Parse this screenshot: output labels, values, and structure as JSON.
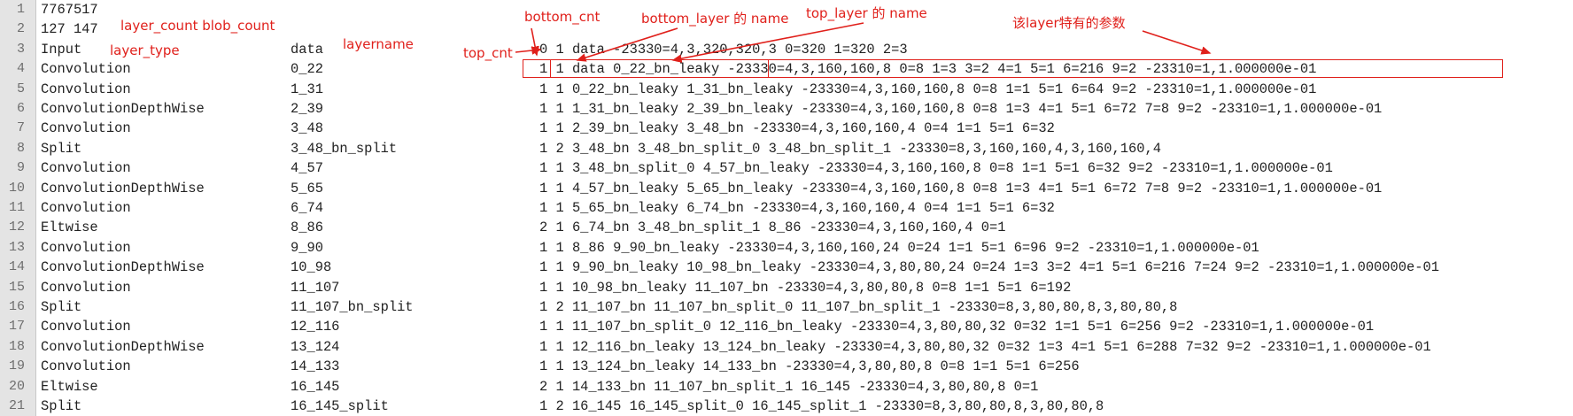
{
  "editor": {
    "lines": [
      {
        "num": "1",
        "type": "7767517",
        "name": "",
        "rest": ""
      },
      {
        "num": "2",
        "type": "127 147",
        "name": "",
        "rest": ""
      },
      {
        "num": "3",
        "type": "Input",
        "name": "data",
        "rest": "0 1 data -23330=4,3,320,320,3 0=320 1=320 2=3"
      },
      {
        "num": "4",
        "type": "Convolution",
        "name": "0_22",
        "rest": "1 1 data 0_22_bn_leaky -23330=4,3,160,160,8 0=8 1=3 3=2 4=1 5=1 6=216 9=2 -23310=1,1.000000e-01"
      },
      {
        "num": "5",
        "type": "Convolution",
        "name": "1_31",
        "rest": "1 1 0_22_bn_leaky 1_31_bn_leaky -23330=4,3,160,160,8 0=8 1=1 5=1 6=64 9=2 -23310=1,1.000000e-01"
      },
      {
        "num": "6",
        "type": "ConvolutionDepthWise",
        "name": "2_39",
        "rest": "1 1 1_31_bn_leaky 2_39_bn_leaky -23330=4,3,160,160,8 0=8 1=3 4=1 5=1 6=72 7=8 9=2 -23310=1,1.000000e-01"
      },
      {
        "num": "7",
        "type": "Convolution",
        "name": "3_48",
        "rest": "1 1 2_39_bn_leaky 3_48_bn -23330=4,3,160,160,4 0=4 1=1 5=1 6=32"
      },
      {
        "num": "8",
        "type": "Split",
        "name": "3_48_bn_split",
        "rest": "1 2 3_48_bn 3_48_bn_split_0 3_48_bn_split_1 -23330=8,3,160,160,4,3,160,160,4"
      },
      {
        "num": "9",
        "type": "Convolution",
        "name": "4_57",
        "rest": "1 1 3_48_bn_split_0 4_57_bn_leaky -23330=4,3,160,160,8 0=8 1=1 5=1 6=32 9=2 -23310=1,1.000000e-01"
      },
      {
        "num": "10",
        "type": "ConvolutionDepthWise",
        "name": "5_65",
        "rest": "1 1 4_57_bn_leaky 5_65_bn_leaky -23330=4,3,160,160,8 0=8 1=3 4=1 5=1 6=72 7=8 9=2 -23310=1,1.000000e-01"
      },
      {
        "num": "11",
        "type": "Convolution",
        "name": "6_74",
        "rest": "1 1 5_65_bn_leaky 6_74_bn -23330=4,3,160,160,4 0=4 1=1 5=1 6=32"
      },
      {
        "num": "12",
        "type": "Eltwise",
        "name": "8_86",
        "rest": "2 1 6_74_bn 3_48_bn_split_1 8_86 -23330=4,3,160,160,4 0=1"
      },
      {
        "num": "13",
        "type": "Convolution",
        "name": "9_90",
        "rest": "1 1 8_86 9_90_bn_leaky -23330=4,3,160,160,24 0=24 1=1 5=1 6=96 9=2 -23310=1,1.000000e-01"
      },
      {
        "num": "14",
        "type": "ConvolutionDepthWise",
        "name": "10_98",
        "rest": "1 1 9_90_bn_leaky 10_98_bn_leaky -23330=4,3,80,80,24 0=24 1=3 3=2 4=1 5=1 6=216 7=24 9=2 -23310=1,1.000000e-01"
      },
      {
        "num": "15",
        "type": "Convolution",
        "name": "11_107",
        "rest": "1 1 10_98_bn_leaky 11_107_bn -23330=4,3,80,80,8 0=8 1=1 5=1 6=192"
      },
      {
        "num": "16",
        "type": "Split",
        "name": "11_107_bn_split",
        "rest": "1 2 11_107_bn 11_107_bn_split_0 11_107_bn_split_1 -23330=8,3,80,80,8,3,80,80,8"
      },
      {
        "num": "17",
        "type": "Convolution",
        "name": "12_116",
        "rest": "1 1 11_107_bn_split_0 12_116_bn_leaky -23330=4,3,80,80,32 0=32 1=1 5=1 6=256 9=2 -23310=1,1.000000e-01"
      },
      {
        "num": "18",
        "type": "ConvolutionDepthWise",
        "name": "13_124",
        "rest": "1 1 12_116_bn_leaky 13_124_bn_leaky -23330=4,3,80,80,32 0=32 1=3 4=1 5=1 6=288 7=32 9=2 -23310=1,1.000000e-01"
      },
      {
        "num": "19",
        "type": "Convolution",
        "name": "14_133",
        "rest": "1 1 13_124_bn_leaky 14_133_bn -23330=4,3,80,80,8 0=8 1=1 5=1 6=256"
      },
      {
        "num": "20",
        "type": "Eltwise",
        "name": "16_145",
        "rest": "2 1 14_133_bn 11_107_bn_split_1 16_145 -23330=4,3,80,80,8 0=1"
      },
      {
        "num": "21",
        "type": "Split",
        "name": "16_145_split",
        "rest": "1 2 16_145 16_145_split_0 16_145_split_1 -23330=8,3,80,80,8,3,80,80,8"
      }
    ]
  },
  "annotations": {
    "counts": "layer_count blob_count",
    "layer_type": "layer_type",
    "layername": "layername",
    "bottom_cnt": "bottom_cnt",
    "top_cnt": "top_cnt",
    "bottom_layer_name": "bottom_layer 的 name",
    "top_layer_name": "top_layer 的 name",
    "params": "该layer特有的参数"
  },
  "colors": {
    "annotation": "#e0201b",
    "gutter": "#e4e4e4"
  }
}
